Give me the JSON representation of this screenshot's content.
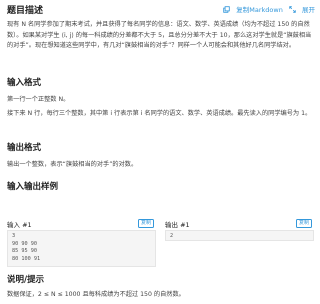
{
  "header": {
    "title": "题目描述",
    "copy_markdown": "复制Markdown",
    "expand": "展开"
  },
  "description": {
    "paragraph1": "现有 N 名同学参加了期末考试，并且获得了每名同学的信息：语文、数学、英语成绩（均为不超过 150 的自然数）。如果某对学生 ⟨i, j⟩ 的每一科成绩的分差都不大于 5，且总分分差不大于 10，那么这对学生就是“旗鼓相当的对手”。现在想知道这些同学中，有几对“旗鼓相当的对手”？同样一个人可能会和其他好几名同学结对。"
  },
  "input_format": {
    "heading": "输入格式",
    "line1": "第一行一个正整数 N。",
    "line2": "接下来 N 行，每行三个整数，其中第 i 行表示第 i 名同学的语文、数学、英语成绩。最先读入的同学编号为 1。"
  },
  "output_format": {
    "heading": "输出格式",
    "line1": "输出一个整数，表示“旗鼓相当的对手”的对数。"
  },
  "samples": {
    "heading": "输入输出样例",
    "input_label": "输入 #1",
    "output_label": "输出 #1",
    "copy_label": "复制",
    "input_lines": [
      "3",
      "90 90 90",
      "85 95 90",
      "80 100 91"
    ],
    "output_lines": [
      "2"
    ]
  },
  "notes": {
    "heading": "说明/提示",
    "line1": "数据保证，2 ≤ N ≤ 1000 且每科成绩为不超过 150 的自然数。"
  },
  "colors": {
    "link": "#3498db",
    "code_bg": "#f5f5f5"
  }
}
